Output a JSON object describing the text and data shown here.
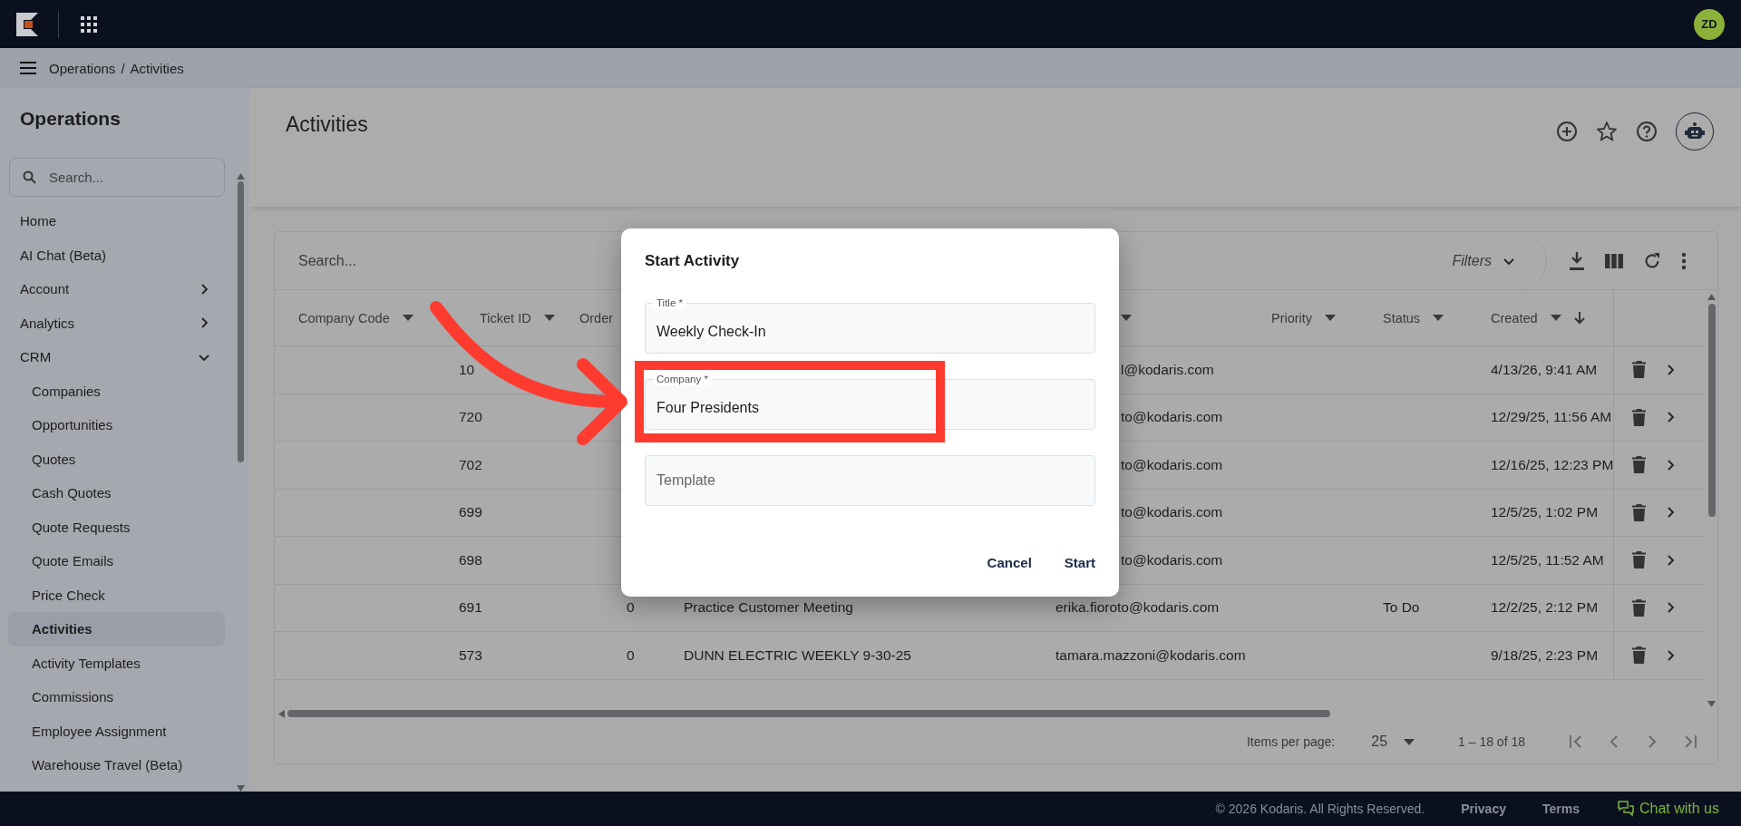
{
  "top_bar": {
    "avatar_initials": "ZD"
  },
  "breadcrumb": {
    "items": [
      "Operations",
      "Activities"
    ],
    "separator": "/"
  },
  "sidebar": {
    "title": "Operations",
    "search_placeholder": "Search...",
    "items": [
      {
        "label": "Home",
        "selected": false
      },
      {
        "label": "AI Chat (Beta)",
        "selected": false
      },
      {
        "label": "Account",
        "selected": false,
        "expanded": false
      },
      {
        "label": "Analytics",
        "selected": false,
        "expanded": false
      },
      {
        "label": "CRM",
        "selected": false,
        "expanded": true,
        "children": [
          {
            "label": "Companies",
            "selected": false
          },
          {
            "label": "Opportunities",
            "selected": false
          },
          {
            "label": "Quotes",
            "selected": false
          },
          {
            "label": "Cash Quotes",
            "selected": false
          },
          {
            "label": "Quote Requests",
            "selected": false
          },
          {
            "label": "Quote Emails",
            "selected": false
          },
          {
            "label": "Price Check",
            "selected": false
          },
          {
            "label": "Activities",
            "selected": true
          },
          {
            "label": "Activity Templates",
            "selected": false
          },
          {
            "label": "Commissions",
            "selected": false
          },
          {
            "label": "Employee Assignment",
            "selected": false
          },
          {
            "label": "Warehouse Travel (Beta)",
            "selected": false
          }
        ]
      }
    ]
  },
  "page": {
    "title": "Activities"
  },
  "table": {
    "search_placeholder": "Search...",
    "filters_label": "Filters",
    "columns": [
      {
        "label": "Company Code",
        "caret": true,
        "sorted": false
      },
      {
        "label": "Ticket ID",
        "caret": true,
        "sorted": false
      },
      {
        "label": "Order",
        "caret": false,
        "sorted": false
      },
      {
        "caret": true,
        "sorted": false
      },
      {
        "label": "Priority",
        "caret": true,
        "sorted": false
      },
      {
        "label": "Status",
        "caret": true,
        "sorted": false
      },
      {
        "label": "Created",
        "caret": true,
        "sorted": true
      }
    ],
    "rows": [
      {
        "ticket_id": "10",
        "email": "l@kodaris.com",
        "created": "4/13/26, 9:41 AM"
      },
      {
        "ticket_id": "720",
        "email": "to@kodaris.com",
        "created": "12/29/25, 11:56 AM"
      },
      {
        "ticket_id": "702",
        "email": "to@kodaris.com",
        "created": "12/16/25, 12:23 PM"
      },
      {
        "ticket_id": "699",
        "email": "to@kodaris.com",
        "created": "12/5/25, 1:02 PM"
      },
      {
        "ticket_id": "698",
        "email": "to@kodaris.com",
        "created": "12/5/25, 11:52 AM"
      },
      {
        "ticket_id": "691",
        "order": "0",
        "title": "Practice Customer Meeting",
        "email": "erika.fioroto@kodaris.com",
        "status": "To Do",
        "created": "12/2/25, 2:12 PM"
      },
      {
        "ticket_id": "573",
        "order": "0",
        "title": "DUNN ELECTRIC WEEKLY 9-30-25",
        "email": "tamara.mazzoni@kodaris.com",
        "created": "9/18/25, 2:23 PM"
      }
    ],
    "pagination": {
      "items_per_page_label": "Items per page:",
      "page_size": "25",
      "range": "1 – 18 of 18"
    }
  },
  "dialog": {
    "title": "Start Activity",
    "fields": [
      {
        "label": "Title *",
        "value": "Weekly Check-In",
        "highlighted": false
      },
      {
        "label": "Company *",
        "value": "Four Presidents",
        "highlighted": true
      },
      {
        "placeholder": "Template",
        "highlighted": false
      }
    ],
    "buttons": [
      "Cancel",
      "Start"
    ]
  },
  "annotation": {
    "kind": "arrow"
  },
  "footer": {
    "copyright": "© 2026 Kodaris. All Rights Reserved.",
    "links": [
      "Privacy",
      "Terms"
    ],
    "chat": "Chat with us"
  }
}
